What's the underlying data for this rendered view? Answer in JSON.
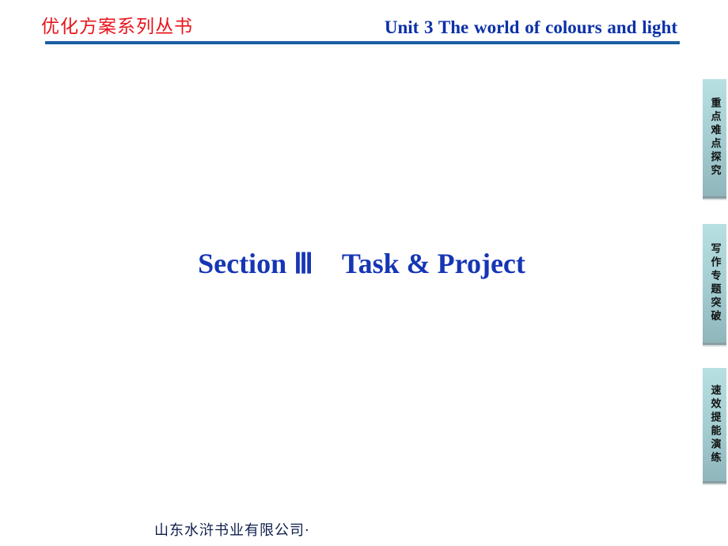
{
  "header": {
    "series_title": "优化方案系列丛书",
    "unit_title": "Unit 3  The world of colours and light",
    "accent_color": "#1a5ea3",
    "series_color": "#e8141c"
  },
  "main": {
    "section_title": "Section Ⅲ　Task & Project"
  },
  "side_tabs": [
    {
      "label": "重点难点探究"
    },
    {
      "label": "写作专题突破"
    },
    {
      "label": "速效提能演练"
    }
  ],
  "footer": {
    "publisher": "山东水浒书业有限公司·"
  }
}
